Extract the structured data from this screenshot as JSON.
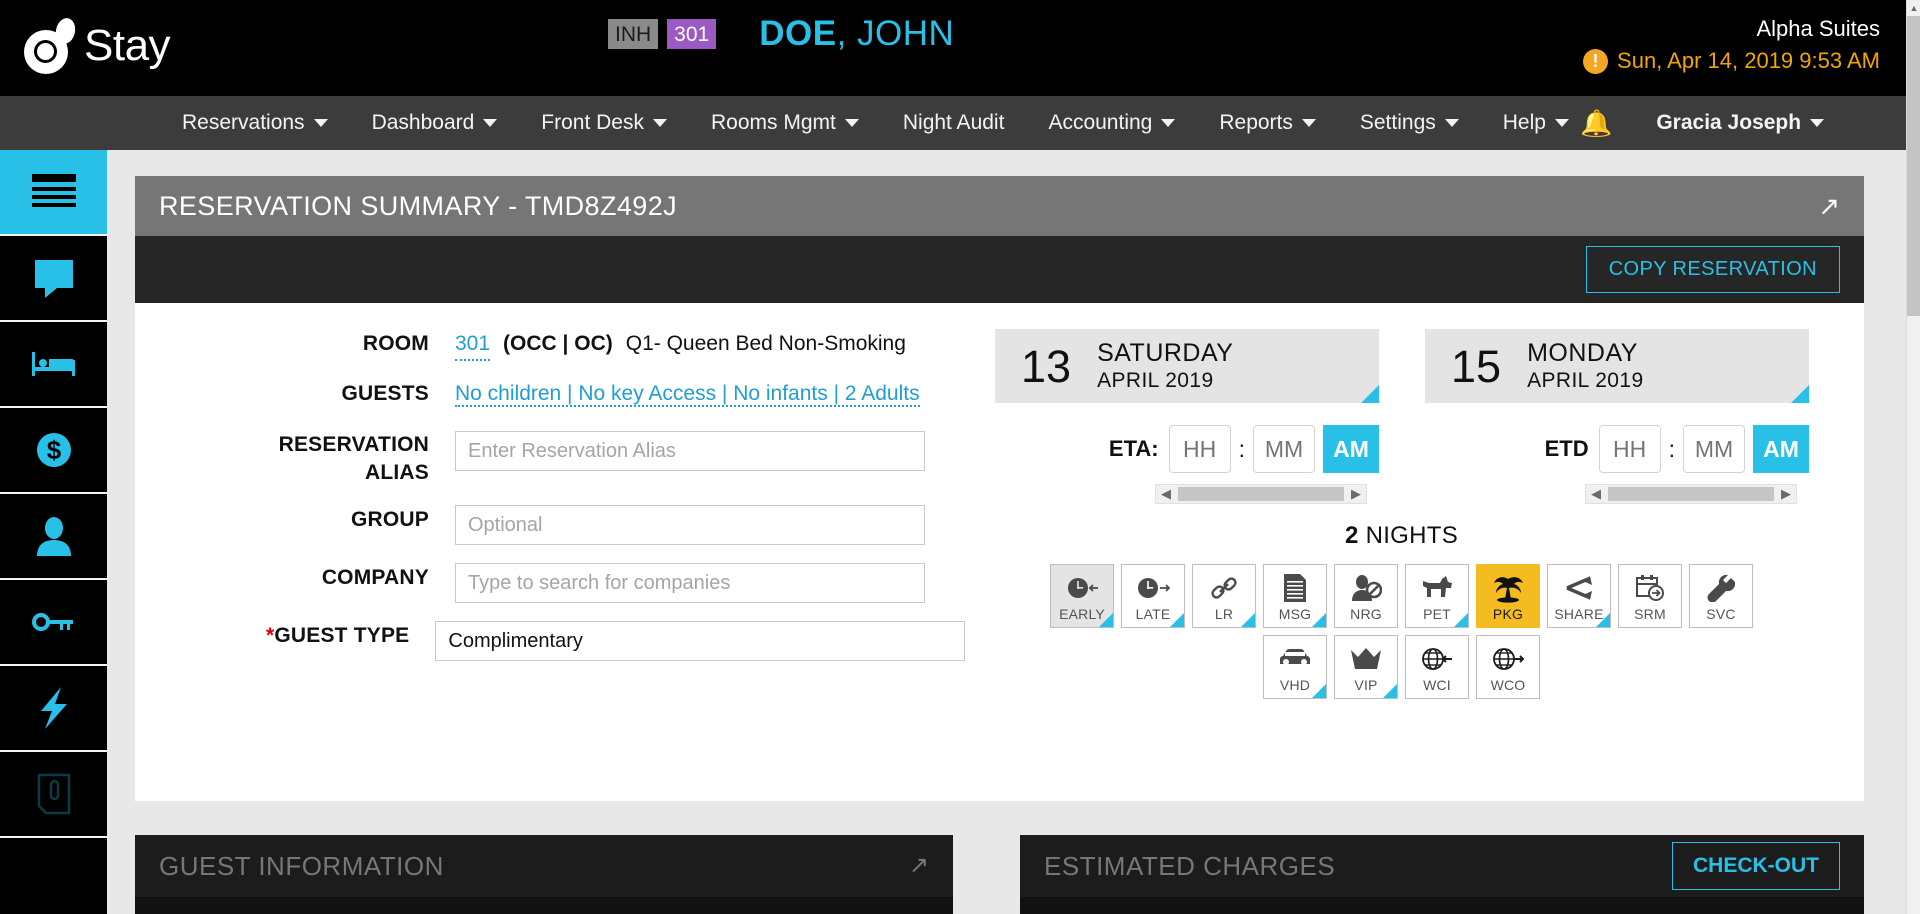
{
  "header": {
    "logo_text": "Stay",
    "status_chip": "INH",
    "room_chip": "301",
    "guest_last": "DOE",
    "guest_first": ", JOHN",
    "property": "Alpha Suites",
    "datetime": "Sun, Apr 14, 2019 9:53 AM",
    "accent": "#29c0e8",
    "warn_color": "#f0a500"
  },
  "nav": {
    "items": [
      {
        "label": "Reservations",
        "caret": true
      },
      {
        "label": "Dashboard",
        "caret": true
      },
      {
        "label": "Front Desk",
        "caret": true
      },
      {
        "label": "Rooms Mgmt",
        "caret": true
      },
      {
        "label": "Night Audit",
        "caret": false
      },
      {
        "label": "Accounting",
        "caret": true
      },
      {
        "label": "Reports",
        "caret": true
      },
      {
        "label": "Settings",
        "caret": true
      },
      {
        "label": "Help",
        "caret": true
      }
    ],
    "user": "Gracia Joseph"
  },
  "sidebar": {
    "items": [
      {
        "icon": "list-menu-icon",
        "name": "summary",
        "active": true
      },
      {
        "icon": "message-icon",
        "name": "messages",
        "active": false
      },
      {
        "icon": "bed-icon",
        "name": "rooms",
        "active": false
      },
      {
        "icon": "dollar-icon",
        "name": "billing",
        "active": false
      },
      {
        "icon": "person-icon",
        "name": "guest",
        "active": false
      },
      {
        "icon": "key-icon",
        "name": "keys",
        "active": false
      },
      {
        "icon": "lightning-icon",
        "name": "quick-actions",
        "active": false
      },
      {
        "icon": "attachment-icon",
        "name": "documents",
        "active": false
      }
    ]
  },
  "card": {
    "title": "RESERVATION SUMMARY - TMD8Z492J",
    "copy_label": "COPY RESERVATION"
  },
  "form": {
    "room_label": "ROOM",
    "room_number": "301",
    "room_status": "(OCC | OC)",
    "room_type": "Q1- Queen Bed Non-Smoking",
    "guests_label": "GUESTS",
    "guests_value": "No children | No key Access | No infants | 2 Adults",
    "alias_label_1": "RESERVATION",
    "alias_label_2": "ALIAS",
    "alias_placeholder": "Enter Reservation Alias",
    "alias_value": "",
    "group_label": "GROUP",
    "group_placeholder": "Optional",
    "group_value": "",
    "company_label": "COMPANY",
    "company_placeholder": "Type to search for companies",
    "company_value": "",
    "guest_type_label": "GUEST TYPE",
    "guest_type_required": "*",
    "guest_type_value": "Complimentary"
  },
  "stay": {
    "arrival": {
      "day": "13",
      "weekday": "SATURDAY",
      "monthyear": "APRIL 2019"
    },
    "departure": {
      "day": "15",
      "weekday": "MONDAY",
      "monthyear": "APRIL 2019"
    },
    "eta_label": "ETA:",
    "etd_label": "ETD",
    "hh_placeholder": "HH",
    "mm_placeholder": "MM",
    "colon": ":",
    "eta_hh": "",
    "eta_mm": "",
    "eta_ampm": "AM",
    "etd_hh": "",
    "etd_mm": "",
    "etd_ampm": "AM",
    "nights_count": "2",
    "nights_word": "NIGHTS",
    "scroll_left": "◀",
    "scroll_right": "▶"
  },
  "flags": {
    "row1": [
      {
        "label": "EARLY",
        "icon": "clock-early-icon",
        "state": "grey",
        "tri": true
      },
      {
        "label": "LATE",
        "icon": "clock-late-icon",
        "state": "none",
        "tri": true
      },
      {
        "label": "LR",
        "icon": "link-icon",
        "state": "none",
        "tri": true
      },
      {
        "label": "MSG",
        "icon": "document-icon",
        "state": "none",
        "tri": true
      },
      {
        "label": "NRG",
        "icon": "no-guest-icon",
        "state": "none",
        "tri": false
      },
      {
        "label": "PET",
        "icon": "dog-icon",
        "state": "none",
        "tri": true
      },
      {
        "label": "PKG",
        "icon": "palm-tree-icon",
        "state": "amber",
        "tri": false
      },
      {
        "label": "SHARE",
        "icon": "share-icon",
        "state": "none",
        "tri": true
      },
      {
        "label": "SRM",
        "icon": "calendar-next-icon",
        "state": "none",
        "tri": false
      },
      {
        "label": "SVC",
        "icon": "wrench-icon",
        "state": "none",
        "tri": false
      }
    ],
    "row2": [
      {
        "label": "VHD",
        "icon": "car-icon",
        "state": "none",
        "tri": true
      },
      {
        "label": "VIP",
        "icon": "crown-icon",
        "state": "none",
        "tri": true
      },
      {
        "label": "WCI",
        "icon": "globe-checkin-icon",
        "state": "none",
        "tri": false
      },
      {
        "label": "WCO",
        "icon": "globe-checkout-icon",
        "state": "none",
        "tri": false
      }
    ]
  },
  "bottom": {
    "guest_info_title": "GUEST INFORMATION",
    "charges_title": "ESTIMATED CHARGES",
    "checkout_label": "CHECK-OUT"
  }
}
